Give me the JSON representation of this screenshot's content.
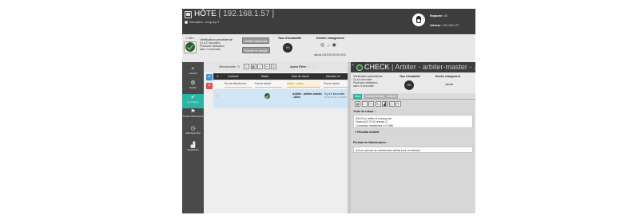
{
  "header": {
    "title": "HÔTE",
    "ip": "192.168.1.57",
    "description": "Description : vm-group 3",
    "realm_label": "Royaume :",
    "realm_value": "All",
    "address_label": "Adresse :",
    "address_value": "192.168.1.57"
  },
  "status": {
    "state_label": "L'hôte :",
    "verif_title": "Vérification précédente",
    "verif_ago": "il y a 27 secondes",
    "next_verif": "Prochaine vérification",
    "next_in": "dans ≈4 secondes",
    "verify_now": "Vérifier maintenant",
    "try_now": "Prendre en compte",
    "instability_title": "Taux d'instabilité",
    "instability_value": "0%",
    "last_change_title": "Dernier changement",
    "last_change_date": "depuis 2019-05-09 09:19:04"
  },
  "sidebar": {
    "items": [
      {
        "icon": "search-icon",
        "glyph": "⌕",
        "label": "Général"
      },
      {
        "icon": "gears-icon",
        "glyph": "⚙",
        "label": "Détails"
      },
      {
        "icon": "checks-icon",
        "glyph": "✔",
        "label": "Les Checks"
      },
      {
        "icon": "flag-icon",
        "glyph": "⚑",
        "label": "Activité Maintenance"
      },
      {
        "icon": "history-icon",
        "glyph": "◷",
        "label": "Historique Etat"
      },
      {
        "icon": "chart-icon",
        "glyph": "▟",
        "label": "Graphiques"
      }
    ]
  },
  "list": {
    "selected_label": "Sélectionnés :",
    "selected_count": "0",
    "filters_label": "Après Filtre :",
    "filters_count": "1 / 1",
    "columns": [
      "Contexte",
      "Statut",
      "Nom de check",
      "Dernière vé"
    ],
    "filters": [
      "Par de sélectionner",
      "Pas de sélecti",
      "Arbiter - arbiter",
      "Pas de sélecti"
    ],
    "rows": [
      {
        "name": "Arbiter - arbiter-master - Alive",
        "last": "il y a 6 secondes",
        "last_date": "2019-05-09 14:26:55"
      }
    ]
  },
  "detail": {
    "title_prefix": "CHECK",
    "title_name": "Arbiter - arbiter-master - ...",
    "verif_title": "Vérification précédente",
    "verif_ago": "il y a 6 secondes",
    "next_verif": "Prochaine vérification",
    "next_in": "dans ≈4 secondes",
    "instability_title": "Taux d'instabilité",
    "instability_value": "0%",
    "last_change_title": "Dernier changement",
    "last_change_value": "Jamais",
    "tabs": [
      "Infos",
      "Contexte et Métr",
      "Avancé"
    ],
    "output_label": "Texte de retour :",
    "output_lines": [
      "[OK] Pour arbiter is running well.",
      "Version [02.07.00-release.1].",
      "Connection established in 0.008s."
    ],
    "detailed_result": "Résultat détaillé",
    "maintenance_label": "Période de Maintenance :",
    "maintenance_text": "Aucune période de maintenance définie pour cet élément"
  }
}
